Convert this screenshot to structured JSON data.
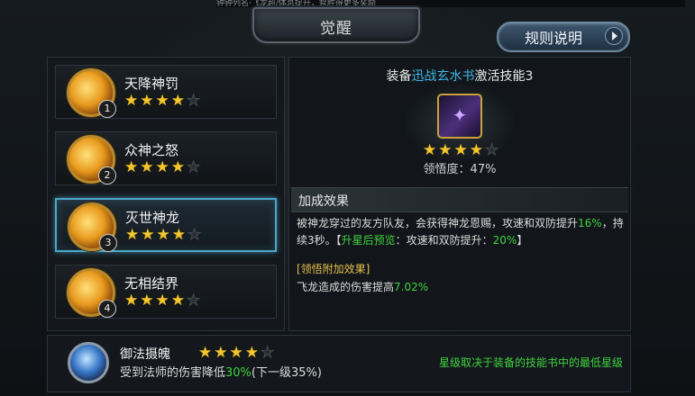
{
  "top_strip_text": "钟钟列名·飞龙超/体息提升，智胜得更多奖励",
  "header": {
    "title": "觉醒",
    "rules_button": "规则说明"
  },
  "skills": [
    {
      "name": "天降神罚",
      "index": "1",
      "stars": 4,
      "max_stars": 5
    },
    {
      "name": "众神之怒",
      "index": "2",
      "stars": 4,
      "max_stars": 5
    },
    {
      "name": "灭世神龙",
      "index": "3",
      "stars": 4,
      "max_stars": 5,
      "selected": true
    },
    {
      "name": "无相结界",
      "index": "4",
      "stars": 4,
      "max_stars": 5
    }
  ],
  "detail": {
    "equip_prefix": "装备",
    "equip_book": "迅战玄水书",
    "equip_suffix": "激活技能3",
    "book_stars": 4,
    "book_max_stars": 5,
    "comprehension": "领悟度：47%",
    "bonus_header": "加成效果",
    "bonus_text_1": "被神龙穿过的友方队友，会获得神龙恩赐，攻速和双防提升",
    "bonus_value_1": "16%",
    "bonus_text_2": "，持续3秒。【",
    "preview_label": "升星后预览",
    "preview_text": "：攻速和双防提升：",
    "preview_value": "20%",
    "preview_close": "】",
    "extra_title": "[领悟附加效果]",
    "extra_text": "飞龙造成的伤害提高",
    "extra_value": "7.02%"
  },
  "bottom": {
    "name": "御法摄魄",
    "stars": 4,
    "max_stars": 5,
    "desc_prefix": "受到法师的伤害降低",
    "desc_value": "30%",
    "desc_suffix": "(下一级35%)",
    "note": "星级取决于装备的技能书中的最低星级"
  },
  "colors": {
    "accent_blue": "#3fb5e6",
    "highlight_green": "#3fd23f",
    "star_gold": "#f3c62f",
    "select_border": "#4da6c6"
  }
}
